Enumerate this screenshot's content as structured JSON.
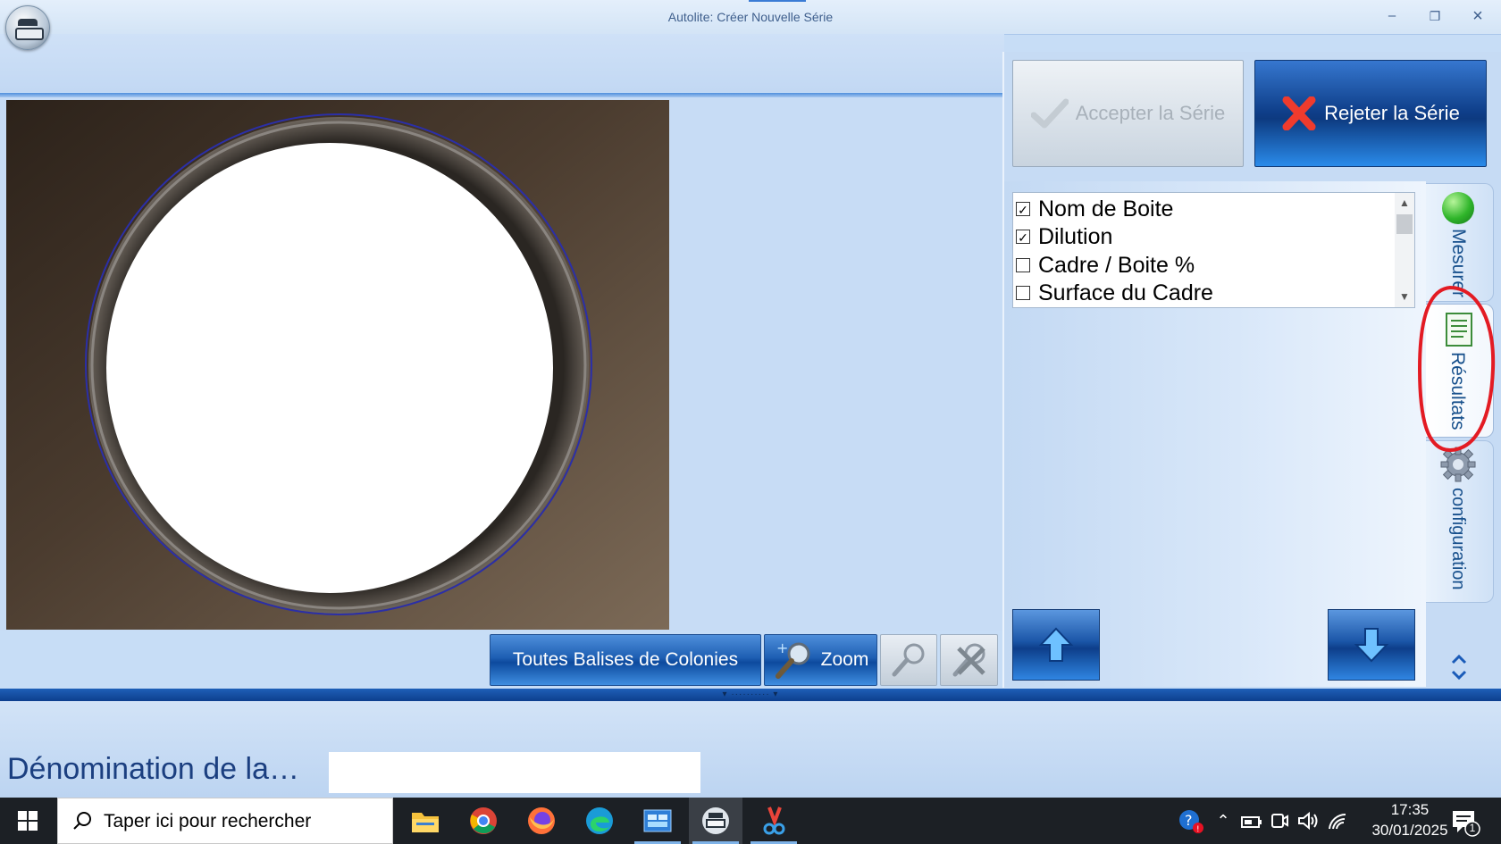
{
  "window": {
    "title": "Autolite: Créer Nouvelle Série",
    "minimize": "–",
    "restore": "❐",
    "close": "×"
  },
  "toolbar": {
    "all_tags_label": "Toutes Balises de Colonies",
    "zoom_label": "Zoom"
  },
  "actions": {
    "accept_label": "Accepter la Série",
    "reject_label": "Rejeter la Série"
  },
  "columns": {
    "items": [
      {
        "label": "Nom de Boite",
        "checked": true
      },
      {
        "label": "Dilution",
        "checked": true
      },
      {
        "label": "Cadre / Boite %",
        "checked": false
      },
      {
        "label": "Surface du Cadre",
        "checked": false
      }
    ]
  },
  "side_tabs": {
    "measure": "Mesurer",
    "results": "Résultats",
    "config": "configuration",
    "active": "Résultats"
  },
  "status": {
    "denomination_label": "Dénomination de la…",
    "denomination_value": ""
  },
  "taskbar": {
    "search_placeholder": "Taper ici pour rechercher",
    "time": "17:35",
    "date": "30/01/2025",
    "notification_count": "1",
    "apps": [
      "file-explorer",
      "chrome",
      "firefox",
      "edge",
      "control-panel",
      "autolite",
      "snipping-tool"
    ]
  },
  "colors": {
    "accent_blue": "#0d3f8d",
    "annotation_red": "#e31b23",
    "panel_bg": "#c7ddf6"
  }
}
